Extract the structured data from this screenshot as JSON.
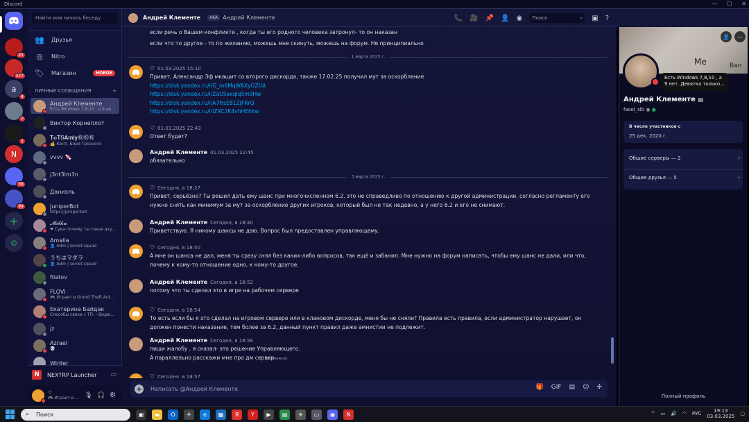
{
  "window": {
    "title": "Discord",
    "controls": [
      "—",
      "☐",
      "✕"
    ]
  },
  "rail": {
    "servers": [
      {
        "label": "",
        "color": "#b71c1c",
        "badge": "21",
        "icon": "red-server-icon"
      },
      {
        "label": "",
        "color": "#c62828",
        "badge": "377",
        "icon": "red-server-icon"
      },
      {
        "label": "a",
        "color": "#3a3f66",
        "badge": "4",
        "icon": "letter-server-icon"
      },
      {
        "label": "",
        "color": "#6d7b8d",
        "badge": "7",
        "icon": "landscape-server-icon"
      },
      {
        "label": "",
        "color": "#1a1a1a",
        "badge": "1",
        "icon": "dark-server-icon"
      },
      {
        "label": "N",
        "color": "#d32f2f",
        "badge": "",
        "icon": "nextrp-server-icon"
      },
      {
        "label": "",
        "color": "#5865f2",
        "badge": "58",
        "icon": "folder-server-icon"
      },
      {
        "label": "",
        "color": "#4752c4",
        "badge": "94",
        "icon": "folder-server-icon"
      }
    ],
    "add_label": "+",
    "explore_label": "⊘"
  },
  "sidebar": {
    "search_placeholder": "Найти или начать беседу",
    "nav": [
      {
        "label": "Друзья",
        "icon": "friends-icon"
      },
      {
        "label": "Nitro",
        "icon": "nitro-icon"
      },
      {
        "label": "Магазин",
        "icon": "shop-icon",
        "badge": "НОВОЕ"
      }
    ],
    "dm_header": "ЛИЧНЫЕ СООБЩЕНИЯ",
    "dm_add": "+",
    "dms": [
      {
        "name": "Андрей Клементе",
        "sub": "Есть Windows 7,8,10 , а 9 нет...",
        "color": "#c99b7a",
        "status": "#f23f43"
      },
      {
        "name": "Виктор Корнеплот",
        "sub": "",
        "color": "#202020",
        "status": "#80848e"
      },
      {
        "name": "𝐓𝐨𝐓𝐒𝐀𝐦𝐥𝐲㊗㊗㊗",
        "sub": "💰 Кент, Боря Грозного",
        "color": "#7a6a5a",
        "status": "#f23f43"
      },
      {
        "name": "vvvv 🍬",
        "sub": "",
        "color": "#5e6a80",
        "status": "#80848e"
      },
      {
        "name": "j3nt3lm3n",
        "sub": "",
        "color": "#5a5a6a",
        "status": "#80848e"
      },
      {
        "name": "Даниэль",
        "sub": "",
        "color": "#4e5058",
        "status": "#80848e"
      },
      {
        "name": "JuniperBot",
        "sub": "https://juniper.bot",
        "color": "#f0a030",
        "status": "#80848e"
      },
      {
        "name": "𝓜𝓲𝓵𝓴𝓪",
        "sub": "❤ Сука почему ты такая аху...",
        "color": "#aa8899",
        "status": "#f23f43"
      },
      {
        "name": "Amalia",
        "sub": "👤 Adm | soviet squad",
        "color": "#88807a",
        "status": "#f23f43"
      },
      {
        "name": "うちはマダラ",
        "sub": "👤 Adm | soviet squad",
        "color": "#554444",
        "status": "#23a55a"
      },
      {
        "name": "filatov",
        "sub": "",
        "color": "#3d5a3d",
        "status": "#80848e"
      },
      {
        "name": "FLOVI",
        "sub": "🎮 Играет в Grand Theft Aut...",
        "color": "#6a6a7a",
        "status": "#f23f43"
      },
      {
        "name": "Екатерина Байдак",
        "sub": "Способы связи с ТП: - Видж...",
        "color": "#b08070",
        "status": "#f23f43"
      },
      {
        "name": "jz",
        "sub": "",
        "color": "#505060",
        "status": "#80848e"
      },
      {
        "name": "Azrael",
        "sub": "💀",
        "color": "#7a7060",
        "status": "#f23f43"
      },
      {
        "name": "Winter",
        "sub": "",
        "color": "#a0a0b0",
        "status": "#80848e"
      }
    ],
    "launcher": {
      "label": "NEXTRP Launcher",
      "icon": "n-icon"
    },
    "user": {
      "name": "♡",
      "status": "🎮 Играет в ..."
    }
  },
  "chat": {
    "header": {
      "name": "Андрей Клементе",
      "aka": "AKA",
      "alias": "Андрей Клементе",
      "search_placeholder": "Поиск"
    },
    "top_lines": [
      "если речь о Вашем конфликте , когда ты его родного человека затронул- то он наказан",
      "если что то другое - то по желанию, можешь мне скинуть, можешь на форум. Не принципиально"
    ],
    "dates": [
      "1 марта 2025 г.",
      "3 марта 2025 г."
    ],
    "messages": [
      {
        "author": "♡",
        "time": "01.03.2025 15:10",
        "self": true,
        "lines": [
          "Привет, Александр Эф мкащит со второго дискорда, также 17.02.25 получил мут за оскорбление"
        ],
        "links": [
          "https://disk.yandex.ru/i/G_m6MqWAXyOZUA",
          "https://disk.yandex.ru/i/ZaU5axqiq5m9Hw",
          "https://disk.yandex.ru/i/A7frsE81ZJFRrQ",
          "https://disk.yandex.ru/i/lZXC2K4vhHEhkw"
        ]
      },
      {
        "author": "♡",
        "time": "01.03.2025 22:43",
        "self": true,
        "lines": [
          "Ответ будет?"
        ]
      },
      {
        "author": "Андрей Клементе",
        "time": "01.03.2025 22:45",
        "self": false,
        "lines": [
          "обязательно"
        ]
      },
      {
        "author": "♡",
        "time": "Сегодня, в 18:27",
        "self": true,
        "lines": [
          "Привет, серьёзно? Ты решил дать ему шанс при многочисленном 6.2, это не справедливо по отношению к другой администрации, согласно регламенту его",
          "нужно снять как минимум за мут за оскорбление других игроков, который был не так недавно, а у него 6.2 и его не снимают."
        ]
      },
      {
        "author": "Андрей Клементе",
        "time": "Сегодня, в 18:40",
        "self": false,
        "lines": [
          "Приветствую. Я никому шансы не даю. Вопрос был предоставлен управляющему."
        ]
      },
      {
        "author": "♡",
        "time": "Сегодня, в 18:50",
        "self": true,
        "lines": [
          "А мне он шанса не дал, меня ты сразу снял без каких-либо вопросов, так ещё и забанил. Мне нужно на форум написать, чтобы ему шанс не дали, или что,",
          "почему к кому-то отношение одно, к кому-то другое."
        ]
      },
      {
        "author": "Андрей Клементе",
        "time": "Сегодня, в 18:52",
        "self": false,
        "lines": [
          "потому что ты сделал это в игре на рабочем сервере"
        ]
      },
      {
        "author": "♡",
        "time": "Сегодня, в 18:54",
        "self": true,
        "lines": [
          "То есть если бы я это сделал на игровом сервере или в клановом дискорде, меня бы не сняли? Правила есть правила, если администратор нарушает, он",
          "должен понести наказание, тем более за 6.2, данный пункт правил даже амнистии не подлежит."
        ]
      },
      {
        "author": "Андрей Клементе",
        "time": "Сегодня, в 18:56",
        "self": false,
        "lines": [
          "пиши жалобу , я сказал- это решение Управляющего.",
          "А параллельно расскажи мне про дм сервер"
        ],
        "edited": "(изменено)"
      },
      {
        "author": "♡",
        "time": "Сегодня, в 18:57",
        "self": true,
        "lines": []
      }
    ],
    "composer_placeholder": "Написать @Андрей Клементе"
  },
  "profile": {
    "banner_texts": [
      "Me",
      "Ban"
    ],
    "tooltip": "Есть Windows 7,8,10 , а 9 нет. Девятка только...",
    "name": "Андрей Клементе",
    "username": "fasel_slb",
    "member_since_label": "В числе участников с",
    "member_since": "25 дек. 2020 г.",
    "mutual_servers": "Общие серверы — 2",
    "mutual_friends": "Общие друзья — 5",
    "full_profile": "Полный профиль"
  },
  "taskbar": {
    "search_placeholder": "Поиск",
    "lang": "РУС",
    "time": "19:13",
    "date": "03.03.2025"
  }
}
